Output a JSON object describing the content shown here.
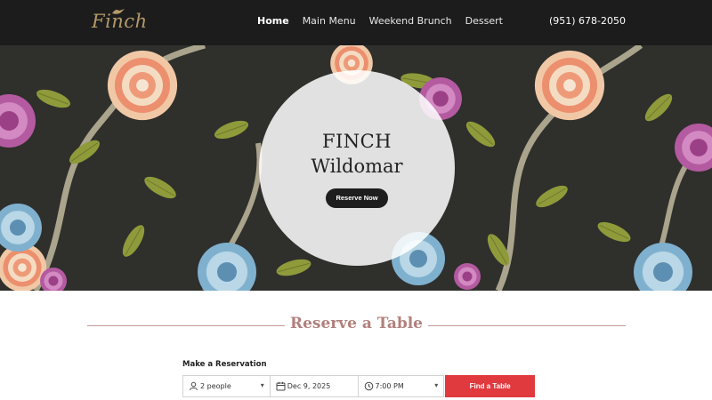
{
  "header": {
    "logo_text": "Finch",
    "nav": [
      {
        "label": "Home",
        "active": true
      },
      {
        "label": "Main Menu",
        "active": false
      },
      {
        "label": "Weekend Brunch",
        "active": false
      },
      {
        "label": "Dessert",
        "active": false
      }
    ],
    "phone": "(951) 678-2050"
  },
  "hero": {
    "title": "FINCH",
    "subtitle": "Wildomar",
    "button_label": "Reserve Now"
  },
  "reservation": {
    "section_title": "Reserve a Table",
    "form_label": "Make a Reservation",
    "party_size": {
      "value": "2 people",
      "icon": "person-icon"
    },
    "date": {
      "value": "Dec 9, 2025",
      "icon": "calendar-icon"
    },
    "time": {
      "value": "7:00 PM",
      "icon": "clock-icon"
    },
    "submit_label": "Find a Table"
  },
  "colors": {
    "header_bg": "#1c1c1c",
    "logo": "#b59a6a",
    "accent_red": "#e0393e",
    "heading_rose": "#b1807c",
    "wallpaper_bg": "#2f2f2c"
  }
}
